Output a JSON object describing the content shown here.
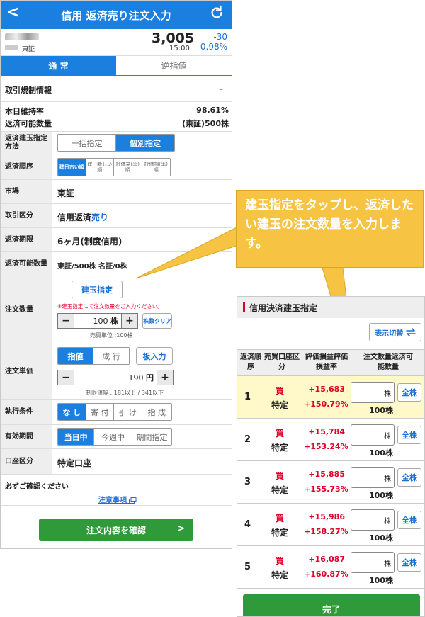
{
  "header": {
    "back": "<",
    "title": "信用 返済売り注文入力"
  },
  "quote": {
    "market": "東証",
    "price": "3,005",
    "time": "15:00",
    "change": "-30",
    "change_pct": "-0.98%"
  },
  "tabs": [
    {
      "label": "通 常"
    },
    {
      "label": "逆指値"
    }
  ],
  "regulation": {
    "label": "取引規制情報",
    "value": "-"
  },
  "maintenance": {
    "label": "本日維持率",
    "value": "98.61%",
    "qty_label": "返済可能数量",
    "qty_value": "(東証)500株"
  },
  "method": {
    "label": "返済建玉指定方法",
    "options": [
      "一括指定",
      "個別指定"
    ]
  },
  "order": {
    "label": "返済順序",
    "options": [
      "建日古い順",
      "建日新しい順",
      "評価益(率)順",
      "評価損(率)順"
    ]
  },
  "market": {
    "label": "市場",
    "value": "東証"
  },
  "trade_type": {
    "label": "取引区分",
    "value": "信用返済",
    "value_hl": "売り"
  },
  "period": {
    "label": "返済期限",
    "value": "6ヶ月(制度信用)"
  },
  "available": {
    "label": "返済可能数量",
    "value": "東証/500株 名証/0株"
  },
  "quantity": {
    "label": "注文数量",
    "select_btn": "建玉指定",
    "warning": "※建玉指定にて注文数量をご入力ください。",
    "value": "100",
    "unit": "株",
    "clear": "株数クリア",
    "unit_note": "売買単位 :100株"
  },
  "price": {
    "label": "注文単価",
    "options": [
      "指値",
      "成 行"
    ],
    "board": "板入力",
    "value": "190",
    "unit": "円",
    "range": "制限値幅 : 181以上 / 341以下"
  },
  "condition": {
    "label": "執行条件",
    "options": [
      "な し",
      "寄 付",
      "引 け",
      "指 成"
    ]
  },
  "expiry": {
    "label": "有効期間",
    "options": [
      "当日中",
      "今週中",
      "期間指定"
    ]
  },
  "account": {
    "label": "口座区分",
    "value": "特定口座"
  },
  "check": {
    "label": "必ずご確認ください",
    "link": "注意事項"
  },
  "confirm_label": "注文内容を確認",
  "callout": "建玉指定をタップし、返済したい建玉の注文数量を入力します。",
  "panel": {
    "title": "信用決済建玉指定",
    "switch": "表示切替",
    "headers": {
      "no": "返済順序",
      "type": "売買口座区分",
      "pl": "評価損益評価損益率",
      "qty": "注文数量返済可能数量"
    },
    "rows": [
      {
        "no": "1",
        "side": "買",
        "acct": "特定",
        "pl": "+15,683",
        "pct": "+150.79%",
        "unit": "株",
        "avail": "100株",
        "all": "全株"
      },
      {
        "no": "2",
        "side": "買",
        "acct": "特定",
        "pl": "+15,784",
        "pct": "+153.24%",
        "unit": "株",
        "avail": "100株",
        "all": "全株"
      },
      {
        "no": "3",
        "side": "買",
        "acct": "特定",
        "pl": "+15,885",
        "pct": "+155.73%",
        "unit": "株",
        "avail": "100株",
        "all": "全株"
      },
      {
        "no": "4",
        "side": "買",
        "acct": "特定",
        "pl": "+15,986",
        "pct": "+158.27%",
        "unit": "株",
        "avail": "100株",
        "all": "全株"
      },
      {
        "no": "5",
        "side": "買",
        "acct": "特定",
        "pl": "+16,087",
        "pct": "+160.87%",
        "unit": "株",
        "avail": "100株",
        "all": "全株"
      }
    ],
    "done": "完了"
  },
  "colors": {
    "primary": "#1b7fe0",
    "green": "#2f9a3a",
    "red": "#e0002a",
    "callout": "#f6c343"
  }
}
